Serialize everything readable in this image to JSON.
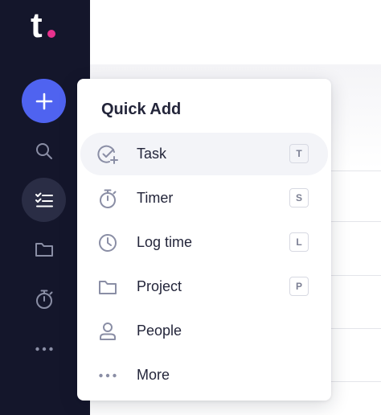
{
  "brand": {
    "logo_letter": "t",
    "accent_color": "#e8318d",
    "sidebar_bg": "#14162b",
    "primary_color": "#4f63f0"
  },
  "sidebar": {
    "add_icon": "plus-icon",
    "items": [
      {
        "icon": "search-icon",
        "active": false
      },
      {
        "icon": "task-list-icon",
        "active": true
      },
      {
        "icon": "folder-icon",
        "active": false
      },
      {
        "icon": "stopwatch-icon",
        "active": false
      },
      {
        "icon": "more-horizontal-icon",
        "active": false
      }
    ]
  },
  "quick_add": {
    "title": "Quick Add",
    "items": [
      {
        "label": "Task",
        "shortcut": "T",
        "icon": "task-check-icon",
        "highlighted": true
      },
      {
        "label": "Timer",
        "shortcut": "S",
        "icon": "stopwatch-icon",
        "highlighted": false
      },
      {
        "label": "Log time",
        "shortcut": "L",
        "icon": "clock-icon",
        "highlighted": false
      },
      {
        "label": "Project",
        "shortcut": "P",
        "icon": "folder-icon",
        "highlighted": false
      },
      {
        "label": "People",
        "shortcut": "",
        "icon": "person-icon",
        "highlighted": false
      },
      {
        "label": "More",
        "shortcut": "",
        "icon": "more-horizontal-icon",
        "highlighted": false
      }
    ]
  }
}
